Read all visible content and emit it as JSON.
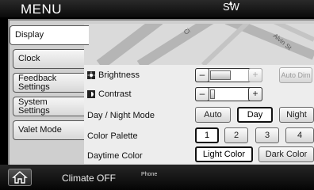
{
  "header": {
    "title": "MENU",
    "compass": "SW"
  },
  "tabs": [
    {
      "label": "Display",
      "active": true
    },
    {
      "label": "Clock",
      "active": false
    },
    {
      "label": "Feedback Settings",
      "active": false
    },
    {
      "label": "System Settings",
      "active": false
    },
    {
      "label": "Valet Mode",
      "active": false
    }
  ],
  "map": {
    "street_a": "Ci",
    "street_b": "Alvin St"
  },
  "settings": {
    "brightness": {
      "label": "Brightness",
      "minus": "–",
      "plus": "+",
      "level": 0.55,
      "auto_label": "Auto Dim"
    },
    "contrast": {
      "label": "Contrast",
      "minus": "–",
      "plus": "+",
      "level": 0.1
    },
    "day_night": {
      "label": "Day / Night Mode",
      "options": [
        "Auto",
        "Day",
        "Night"
      ],
      "selected": "Day"
    },
    "palette": {
      "label": "Color Palette",
      "options": [
        "1",
        "2",
        "3",
        "4"
      ],
      "selected": "1"
    },
    "daytime_color": {
      "label": "Daytime Color",
      "options": [
        "Light Color",
        "Dark Color"
      ],
      "selected": "Light Color"
    }
  },
  "footer": {
    "climate": "Climate OFF",
    "phone": "Phone"
  }
}
